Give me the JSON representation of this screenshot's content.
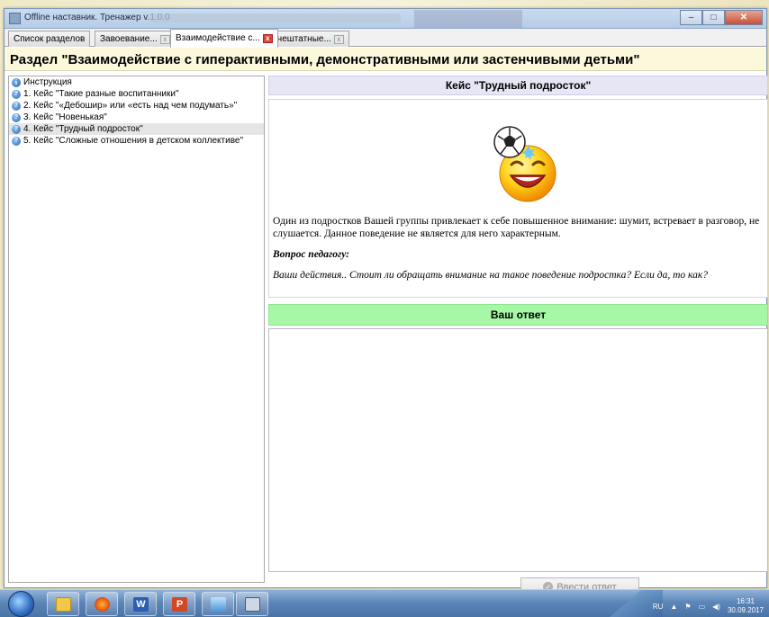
{
  "window": {
    "title": "Offline наставник. Тренажер v.1.0.0",
    "controls": [
      "minimize",
      "maximize",
      "close"
    ]
  },
  "tabs": [
    {
      "label": "Список разделов",
      "closable": false,
      "active": false
    },
    {
      "label": "Завоевание...",
      "closable": true,
      "active": false
    },
    {
      "label": "Взаимодействие с...",
      "closable": true,
      "active": true
    },
    {
      "label": "Внештатные...",
      "closable": true,
      "active": false
    }
  ],
  "section": {
    "title": "Раздел \"Взаимодействие с гиперактивными, демонстративными или застенчивыми детьми\""
  },
  "tree": {
    "items": [
      {
        "label": "Инструкция",
        "icon": "info-icon",
        "selected": false
      },
      {
        "label": "1. Кейс \"Такие разные воспитанники\"",
        "icon": "question-icon",
        "selected": false
      },
      {
        "label": "2. Кейс \"«Дебошир» или «есть над чем подумать»\"",
        "icon": "question-icon",
        "selected": false
      },
      {
        "label": "3. Кейс \"Новенькая\"",
        "icon": "question-icon",
        "selected": false
      },
      {
        "label": "4. Кейс \"Трудный подросток\"",
        "icon": "question-icon",
        "selected": true
      },
      {
        "label": "5. Кейс \"Сложные отношения в детском коллективе\"",
        "icon": "question-icon",
        "selected": false
      }
    ]
  },
  "case": {
    "title": "Кейс \"Трудный подросток\"",
    "image": "laughing-smiley-with-soccer-ball",
    "description": "Один из подростков Вашей группы привлекает к себе повышенное внимание: шумит, встревает в разговор, не слушается. Данное поведение не является для него характерным.",
    "question_label": "Вопрос педагогу:",
    "question_text": "Ваши действия.. Стоит ли обращать внимание на такое поведение подростка? Если да, то как?"
  },
  "answer": {
    "header": "Ваш ответ",
    "value": "",
    "submit_label": "Ввести ответ"
  },
  "taskbar": {
    "apps": [
      "explorer",
      "firefox",
      "word",
      "powerpoint",
      "control-panel",
      "trainer"
    ],
    "language": "RU",
    "time": "16:31",
    "date": "30.09.2017"
  },
  "colors": {
    "section_bg": "#fbf8dc",
    "case_title_bg": "#e6e6f5",
    "answer_header_bg": "#a6f7a6",
    "tab_close_active": "#d9453b"
  }
}
